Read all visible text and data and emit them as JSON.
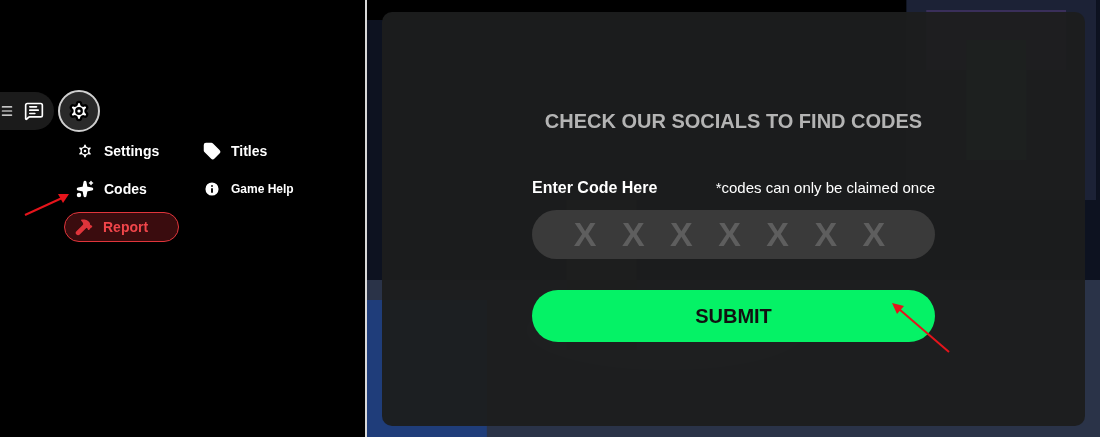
{
  "menu": {
    "items": [
      {
        "kind": "settings",
        "label": "Settings"
      },
      {
        "kind": "titles",
        "label": "Titles"
      },
      {
        "kind": "codes",
        "label": "Codes"
      },
      {
        "kind": "help",
        "label": "Game Help"
      },
      {
        "kind": "report",
        "label": "Report"
      }
    ]
  },
  "codes_panel": {
    "heading": "CHECK OUR SOCIALS TO FIND CODES",
    "label": "Enter Code Here",
    "note": "*codes can only be claimed once",
    "placeholder": "X X X X X X X",
    "submit": "SUBMIT"
  }
}
